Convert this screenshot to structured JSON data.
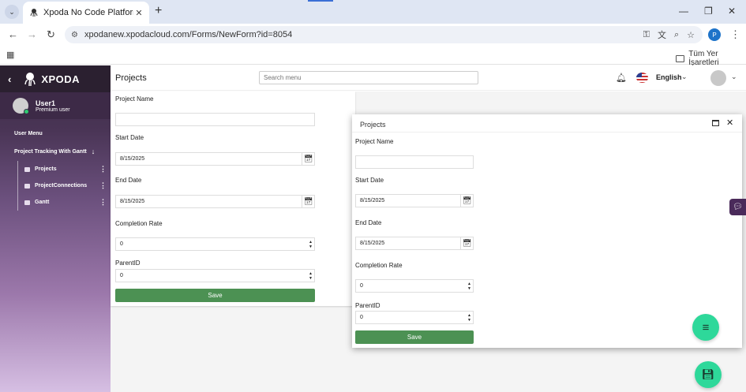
{
  "browser": {
    "tab_title": "Xpoda No Code Platform",
    "url": "xpodanew.xpodacloud.com/Forms/NewForm?id=8054",
    "profile_initial": "P",
    "bookmark_folder": "Tüm Yer İşaretleri"
  },
  "app": {
    "logo_text": "XPODA",
    "user_name": "User1",
    "user_role": "Premium user",
    "user_menu_title": "User Menu",
    "menu_group": "Project Tracking With Gantt",
    "menu_items": [
      {
        "label": "Projects"
      },
      {
        "label": "ProjectConnections"
      },
      {
        "label": "Gantt"
      }
    ],
    "page_title": "Projects",
    "search_placeholder": "Search menu",
    "language": "English"
  },
  "form": {
    "project_name_label": "Project Name",
    "project_name_value": "",
    "start_date_label": "Start Date",
    "start_date_value": "8/15/2025",
    "end_date_label": "End Date",
    "end_date_value": "8/15/2025",
    "completion_rate_label": "Completion Rate",
    "completion_rate_value": "0",
    "parent_id_label": "ParentID",
    "parent_id_value": "0",
    "save_label": "Save"
  },
  "modal": {
    "title": "Projects",
    "project_name_label": "Project Name",
    "project_name_value": "",
    "start_date_label": "Start Date",
    "start_date_value": "8/15/2025",
    "end_date_label": "End Date",
    "end_date_value": "8/15/2025",
    "completion_rate_label": "Completion Rate",
    "completion_rate_value": "0",
    "parent_id_label": "ParentID",
    "parent_id_value": "0",
    "save_label": "Save"
  },
  "colors": {
    "save_button": "#4c9153",
    "fab": "#2ed89a",
    "sidebar_top": "#3a2a44",
    "sidebar_bottom": "#d6bfe3"
  },
  "icons": [
    "tab-list-icon",
    "octopus-icon",
    "close-icon",
    "plus-icon",
    "back-icon",
    "forward-icon",
    "reload-icon",
    "key-icon",
    "translate-icon",
    "zoom-icon",
    "star-icon",
    "apps-icon",
    "folder-icon",
    "bell-icon",
    "us-flag-icon",
    "chevron-down-icon",
    "calendar-icon",
    "spinner-icon",
    "maximize-icon",
    "menu-icon",
    "floppy-icon",
    "chat-icon"
  ]
}
